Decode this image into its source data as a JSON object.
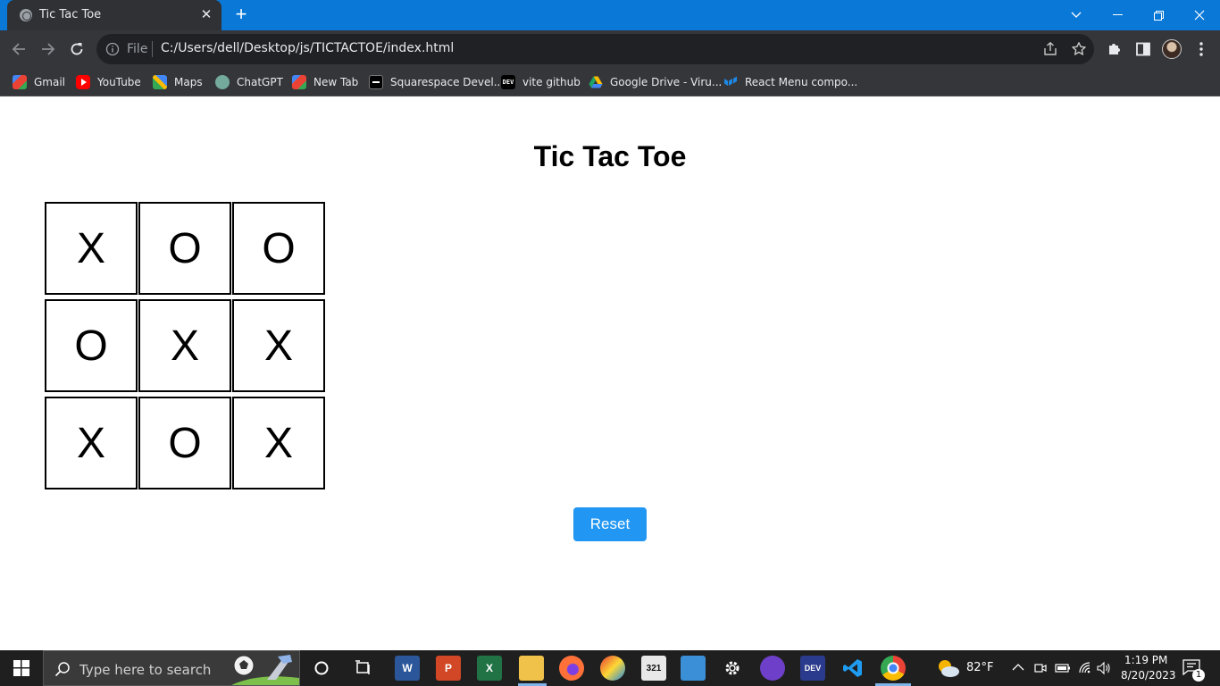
{
  "browser": {
    "tab_title": "Tic Tac Toe",
    "omnibox_scheme": "File",
    "url": "C:/Users/dell/Desktop/js/TICTACTOE/index.html"
  },
  "bookmarks": [
    {
      "label": "Gmail",
      "icon": "gmail-icon",
      "color": "#ea4335"
    },
    {
      "label": "YouTube",
      "icon": "youtube-icon",
      "color": "#ff0000"
    },
    {
      "label": "Maps",
      "icon": "maps-icon",
      "color": "#34a853"
    },
    {
      "label": "ChatGPT",
      "icon": "chatgpt-icon",
      "color": "#74aa9c"
    },
    {
      "label": "New Tab",
      "icon": "gmail-icon",
      "color": "#ea4335"
    },
    {
      "label": "Squarespace Devel...",
      "icon": "squarespace-icon",
      "color": "#000000"
    },
    {
      "label": "vite github",
      "icon": "dev-icon",
      "color": "#000000"
    },
    {
      "label": "Google Drive - Viru...",
      "icon": "google-drive-icon",
      "color": "#1fa463"
    },
    {
      "label": "React Menu compo...",
      "icon": "mui-icon",
      "color": "#1e88e5"
    }
  ],
  "page": {
    "heading": "Tic Tac Toe",
    "board": [
      [
        "X",
        "O",
        "O"
      ],
      [
        "O",
        "X",
        "X"
      ],
      [
        "X",
        "O",
        "X"
      ]
    ],
    "reset_label": "Reset",
    "reset_color": "#2196f3"
  },
  "taskbar": {
    "search_placeholder": "Type here to search",
    "weather": "82°F",
    "time": "1:19 PM",
    "date": "8/20/2023",
    "notification_count": "1"
  }
}
